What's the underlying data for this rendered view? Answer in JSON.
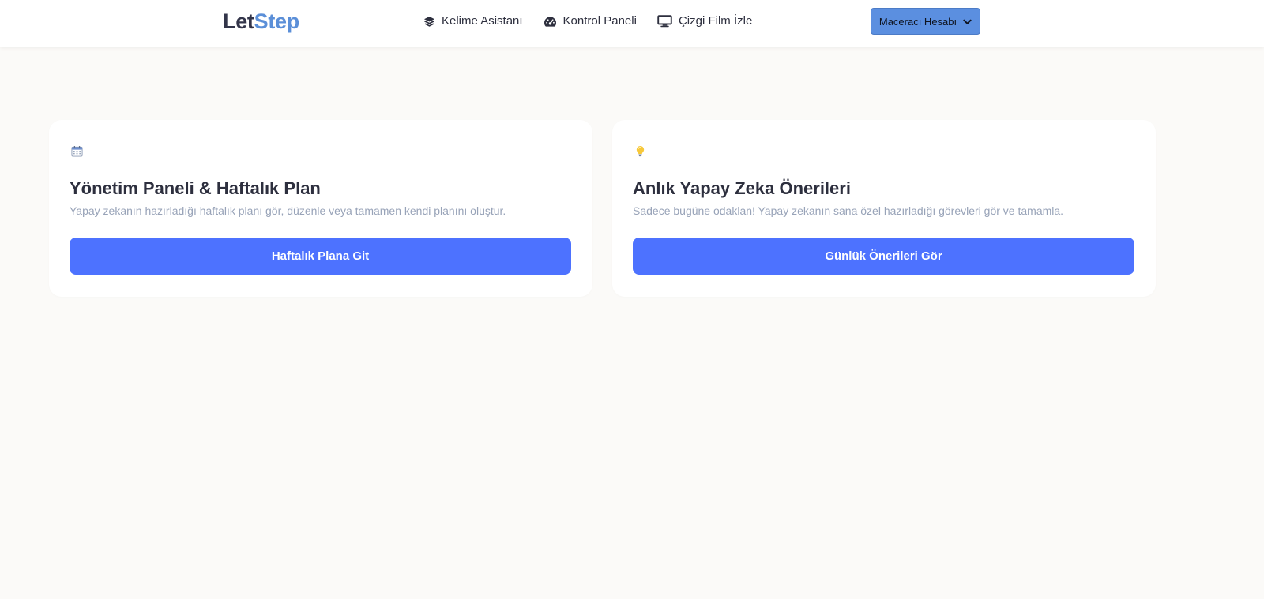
{
  "header": {
    "logo": {
      "part1": "Let",
      "part2": "Step"
    },
    "nav": [
      {
        "label": "Kelime Asistanı",
        "icon": "layers-icon"
      },
      {
        "label": "Kontrol Paneli",
        "icon": "gauge-icon"
      },
      {
        "label": "Çizgi Film İzle",
        "icon": "monitor-icon"
      }
    ],
    "account": {
      "label": "Maceracı Hesabı",
      "icon": "chevron-down-icon"
    }
  },
  "cards": [
    {
      "icon": "calendar-icon",
      "title": "Yönetim Paneli & Haftalık Plan",
      "description": "Yapay zekanın hazırladığı haftalık planı gör, düzenle veya tamamen kendi planını oluştur.",
      "button": "Haftalık Plana Git"
    },
    {
      "icon": "lightbulb-icon",
      "title": "Anlık Yapay Zeka Önerileri",
      "description": "Sadece bugüne odaklan! Yapay zekanın sana özel hazırladığı görevleri gör ve tamamla.",
      "button": "Günlük Önerileri Gör"
    }
  ],
  "colors": {
    "background": "#fbfaf8",
    "logo_dark": "#33354a",
    "logo_accent": "#5b8fd8",
    "account_button": "#5b8fe0",
    "primary_button": "#4d72ff",
    "muted_text": "#98a3b8"
  }
}
